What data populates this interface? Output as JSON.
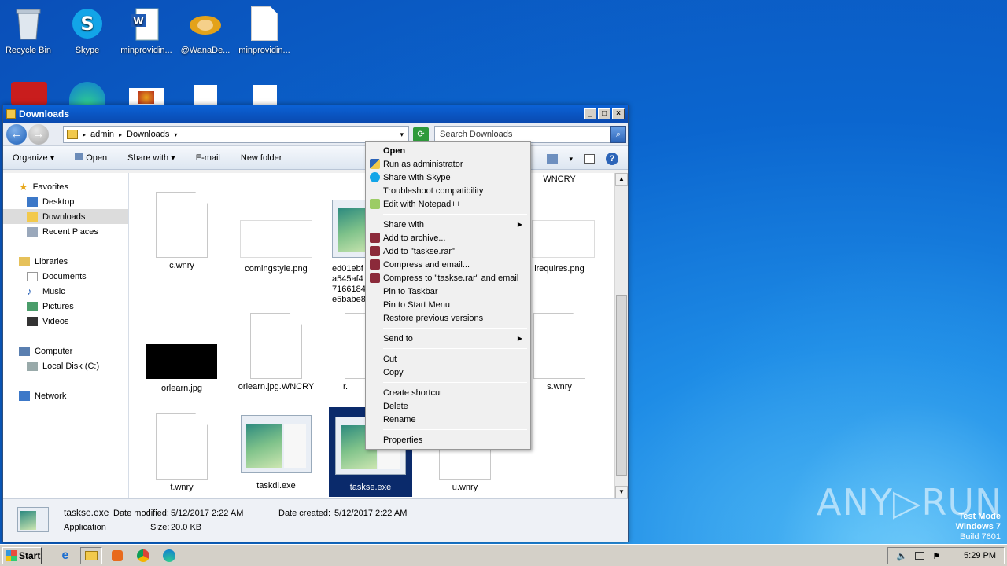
{
  "desktop": {
    "icons": [
      {
        "label": "Recycle Bin",
        "icon": "recycle-bin-icon"
      },
      {
        "label": "Skype",
        "icon": "skype-icon"
      },
      {
        "label": "minprovidin...",
        "icon": "word-document-icon"
      },
      {
        "label": "@WanaDe...",
        "icon": "handshake-icon"
      },
      {
        "label": "minprovidin...",
        "icon": "blank-document-icon"
      }
    ],
    "watermark": {
      "line1": "Test Mode",
      "line2": "Windows 7",
      "line3": "Build 7601"
    },
    "brand": "ANY▷RUN"
  },
  "window": {
    "title": "Downloads",
    "address": {
      "crumb1": "admin",
      "crumb2": "Downloads"
    },
    "search_placeholder": "Search Downloads",
    "toolbar": {
      "organize": "Organize",
      "open": "Open",
      "share_with": "Share with",
      "email": "E-mail",
      "new_folder": "New folder"
    },
    "nav": {
      "favorites": "Favorites",
      "desktop": "Desktop",
      "downloads": "Downloads",
      "recent": "Recent Places",
      "libraries": "Libraries",
      "documents": "Documents",
      "music": "Music",
      "pictures": "Pictures",
      "videos": "Videos",
      "computer": "Computer",
      "local_disk": "Local Disk (C:)",
      "network": "Network"
    },
    "files": {
      "c_wnry": "c.wnry",
      "comingstyle": "comingstyle.png",
      "ed01": "ed01ebf",
      "ed02": "a545af4",
      "ed03": "7166184",
      "ed04": "e5babe8",
      "wncry_top": "WNCRY",
      "irequires": "irequires.png",
      "orlearn_jpg": "orlearn.jpg",
      "orlearn_wncry": "orlearn.jpg.WNCRY",
      "r_partial": "r.",
      "s_wnry": "s.wnry",
      "t_wnry": "t.wnry",
      "taskdl": "taskdl.exe",
      "taskse": "taskse.exe",
      "u_wnry": "u.wnry"
    },
    "details": {
      "name": "taskse.exe",
      "modified_label": "Date modified:",
      "modified": "5/12/2017 2:22 AM",
      "created_label": "Date created:",
      "created": "5/12/2017 2:22 AM",
      "type": "Application",
      "size_label": "Size:",
      "size": "20.0 KB"
    }
  },
  "context_menu": {
    "open": "Open",
    "run_admin": "Run as administrator",
    "share_skype": "Share with Skype",
    "troubleshoot": "Troubleshoot compatibility",
    "notepad": "Edit with Notepad++",
    "share_with": "Share with",
    "add_archive": "Add to archive...",
    "add_rar": "Add to \"taskse.rar\"",
    "compress_email": "Compress and email...",
    "compress_rar_email": "Compress to \"taskse.rar\" and email",
    "pin_taskbar": "Pin to Taskbar",
    "pin_start": "Pin to Start Menu",
    "restore": "Restore previous versions",
    "send_to": "Send to",
    "cut": "Cut",
    "copy": "Copy",
    "create_shortcut": "Create shortcut",
    "delete": "Delete",
    "rename": "Rename",
    "properties": "Properties"
  },
  "taskbar": {
    "start": "Start",
    "clock": "5:29 PM"
  },
  "colors": {
    "accent": "#0b62d6",
    "selection": "#0a2a6b",
    "desktop": "#1e8ce6"
  }
}
